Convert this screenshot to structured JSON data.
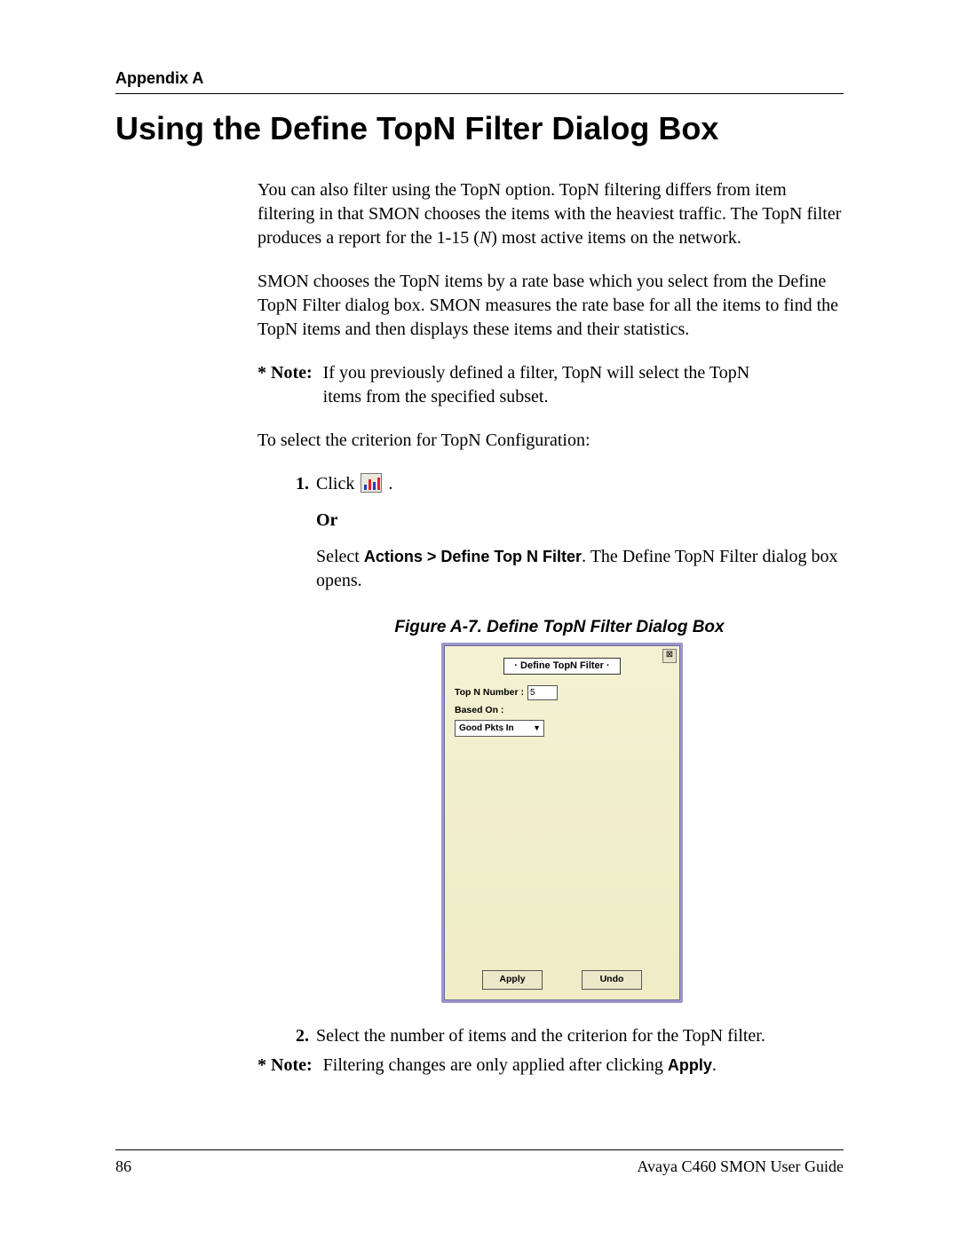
{
  "appendix_label": "Appendix A",
  "title": "Using the Define TopN Filter Dialog Box",
  "para1": "You can also filter using the TopN option. TopN filtering differs from item filtering in that SMON chooses the items with the heaviest traffic. The TopN filter produces a report for the 1-15 (",
  "para1_italic": "N",
  "para1_tail": ") most active items on the network.",
  "para2": "SMON chooses the TopN items by a rate base which you select from the Define TopN Filter dialog box. SMON measures the rate base for all the items to find the TopN items and then displays these items and their statistics.",
  "note1_label": "* Note:",
  "note1_text_line1": "If you previously defined a filter, TopN will select the TopN",
  "note1_text_line2": "items from the specified subset.",
  "para3": "To select the criterion for TopN Configuration:",
  "step1_num": "1.",
  "step1_text_before": "Click ",
  "step1_text_after": " .",
  "or_label": "Or",
  "step1b_before": "Select ",
  "step1b_bold": "Actions > Define Top N Filter",
  "step1b_after": ". The Define TopN Filter dialog box opens.",
  "figure_caption": "Figure A-7.  Define TopN Filter Dialog Box",
  "dialog": {
    "title": "· Define TopN Filter ·",
    "close_glyph": "⊠",
    "topn_label": "Top N Number :",
    "topn_value": "5",
    "basedon_label": "Based On :",
    "basedon_value": "Good Pkts In",
    "apply": "Apply",
    "undo": "Undo"
  },
  "step2_num": "2.",
  "step2_text": "Select the number of items and the criterion for the TopN filter.",
  "note2_label": "* Note:",
  "note2_text_before": "Filtering changes are only applied after clicking ",
  "note2_bold": "Apply",
  "note2_text_after": ".",
  "footer_page": "86",
  "footer_doc": "Avaya C460 SMON User Guide"
}
